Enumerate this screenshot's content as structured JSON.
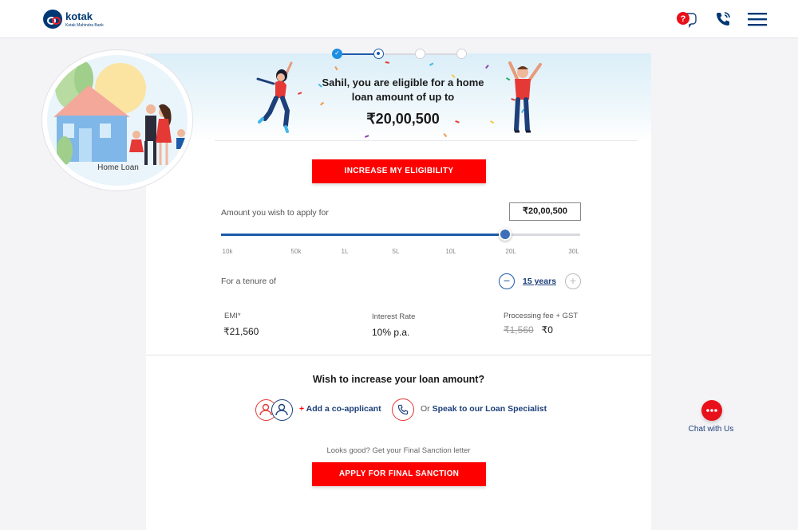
{
  "header": {
    "logo_name": "kotak",
    "logo_sub": "Kotak Mahindra Bank"
  },
  "stepper": {
    "steps_total": 4,
    "steps_done": 1,
    "active_step": 2
  },
  "eligibility": {
    "message": "Sahil, you are eligible for a home loan amount of up to",
    "amount": "₹20,00,500",
    "increase_button": "INCREASE MY ELIGIBILITY"
  },
  "product": {
    "label": "Home Loan"
  },
  "loan_amount": {
    "label": "Amount you wish to apply for",
    "value": "₹20,00,500",
    "slider_position": 0.79,
    "ticks": [
      "10k",
      "50k",
      "1L",
      "5L",
      "10L",
      "20L",
      "30L"
    ]
  },
  "tenure": {
    "label": "For a tenure of",
    "value": "15 years"
  },
  "stats": {
    "emi_label": "EMI*",
    "emi_value": "₹21,560",
    "rate_label": "Interest Rate",
    "rate_value": "10% p.a.",
    "fee_label": "Processing fee + GST",
    "fee_old": "₹1,560",
    "fee_new": "₹0"
  },
  "increase_section": {
    "title": "Wish to increase your loan amount?",
    "co_applicant_plus": "+",
    "co_applicant_label": "Add a co-applicant",
    "speak_prefix": "Or",
    "speak_label": "Speak to our Loan Specialist"
  },
  "final": {
    "hint": "Looks good? Get your Final Sanction letter",
    "button": "APPLY FOR FINAL SANCTION"
  },
  "chat": {
    "label": "Chat with Us"
  },
  "colors": {
    "brand_blue": "#003874",
    "accent_red": "#ff0000",
    "link_blue": "#1d3f7a"
  }
}
